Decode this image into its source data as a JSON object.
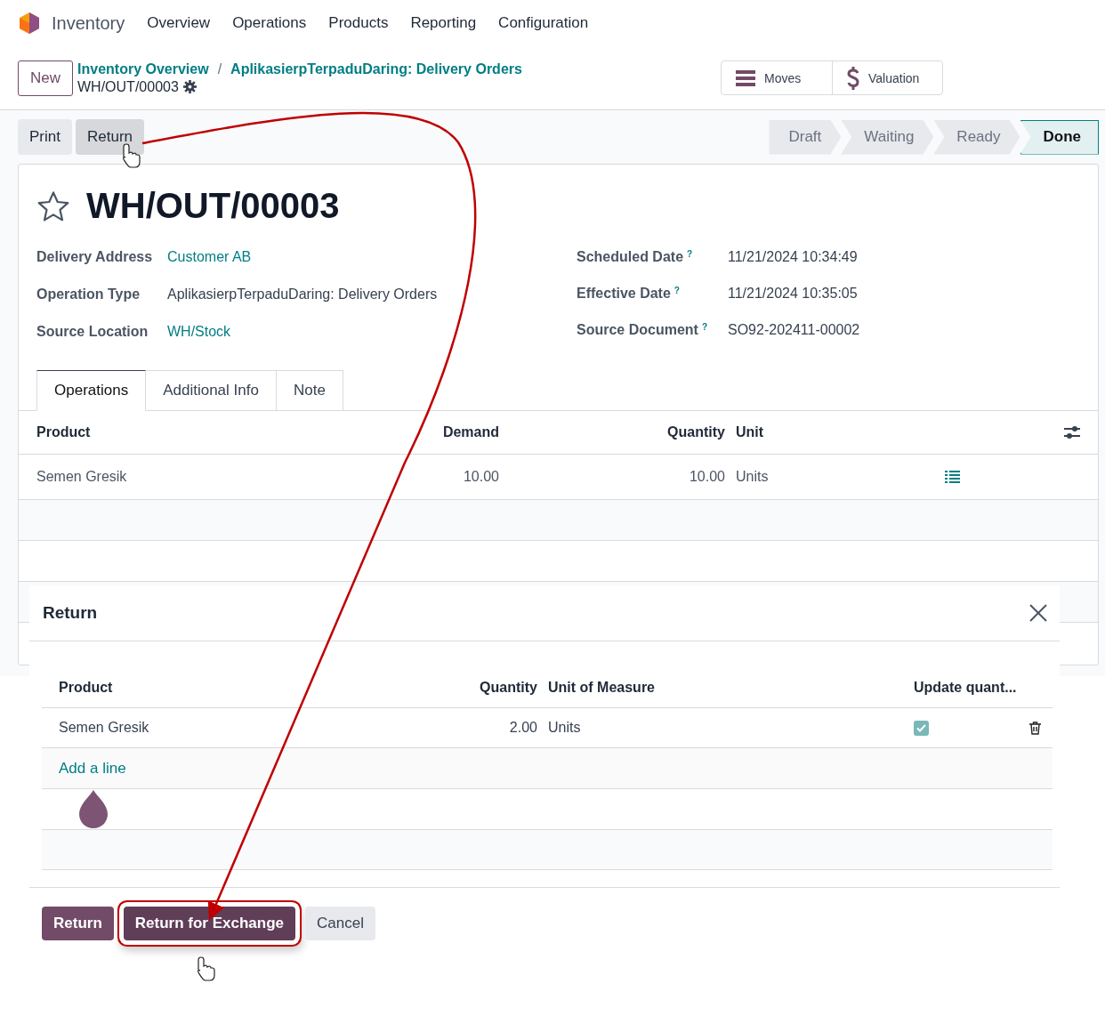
{
  "navbar": {
    "app": "Inventory",
    "menu": [
      "Overview",
      "Operations",
      "Products",
      "Reporting",
      "Configuration"
    ]
  },
  "control_panel": {
    "new_button": "New",
    "breadcrumbs": [
      "Inventory Overview",
      "AplikasierpTerpaduDaring: Delivery Orders"
    ],
    "separator": "/",
    "current": "WH/OUT/00003",
    "stat_buttons": [
      {
        "kind": "moves",
        "label": "Moves"
      },
      {
        "kind": "valuation",
        "label": "Valuation"
      }
    ]
  },
  "action_buttons": [
    {
      "label": "Print",
      "hovered": false
    },
    {
      "label": "Return",
      "hovered": true
    }
  ],
  "status_steps": [
    {
      "label": "Draft",
      "selected": false
    },
    {
      "label": "Waiting",
      "selected": false
    },
    {
      "label": "Ready",
      "selected": false
    },
    {
      "label": "Done",
      "selected": true
    }
  ],
  "record": {
    "starred": false,
    "title": "WH/OUT/00003",
    "fields_left": [
      {
        "label": "Delivery Address",
        "value": "Customer AB",
        "link": true
      },
      {
        "label": "Operation Type",
        "value": "AplikasierpTerpaduDaring: Delivery Orders",
        "link": false
      },
      {
        "label": "Source Location",
        "value": "WH/Stock",
        "link": true
      }
    ],
    "fields_right": [
      {
        "label": "Scheduled Date",
        "help": "?",
        "value": "11/21/2024 10:34:49"
      },
      {
        "label": "Effective Date",
        "help": "?",
        "value": "11/21/2024 10:35:05"
      },
      {
        "label": "Source Document",
        "help": "?",
        "value": "SO92-202411-00002"
      }
    ]
  },
  "tabs": [
    {
      "label": "Operations",
      "selected": true
    },
    {
      "label": "Additional Info",
      "selected": false
    },
    {
      "label": "Note",
      "selected": false
    }
  ],
  "operations_table": {
    "columns": [
      "Product",
      "Demand",
      "Quantity",
      "Unit"
    ],
    "rows": [
      {
        "product": "Semen Gresik",
        "demand": "10.00",
        "quantity": "10.00",
        "unit": "Units"
      }
    ]
  },
  "dialog": {
    "title": "Return",
    "columns": [
      "Product",
      "Quantity",
      "Unit of Measure",
      "Update quant..."
    ],
    "rows": [
      {
        "product": "Semen Gresik",
        "quantity": "2.00",
        "unit": "Units",
        "update": true
      }
    ],
    "add_line": "Add a line",
    "buttons": [
      {
        "label": "Return",
        "kind": "primary",
        "highlighted": false
      },
      {
        "label": "Return for Exchange",
        "kind": "primary",
        "highlighted": true
      },
      {
        "label": "Cancel",
        "kind": "secondary",
        "highlighted": false
      }
    ]
  }
}
